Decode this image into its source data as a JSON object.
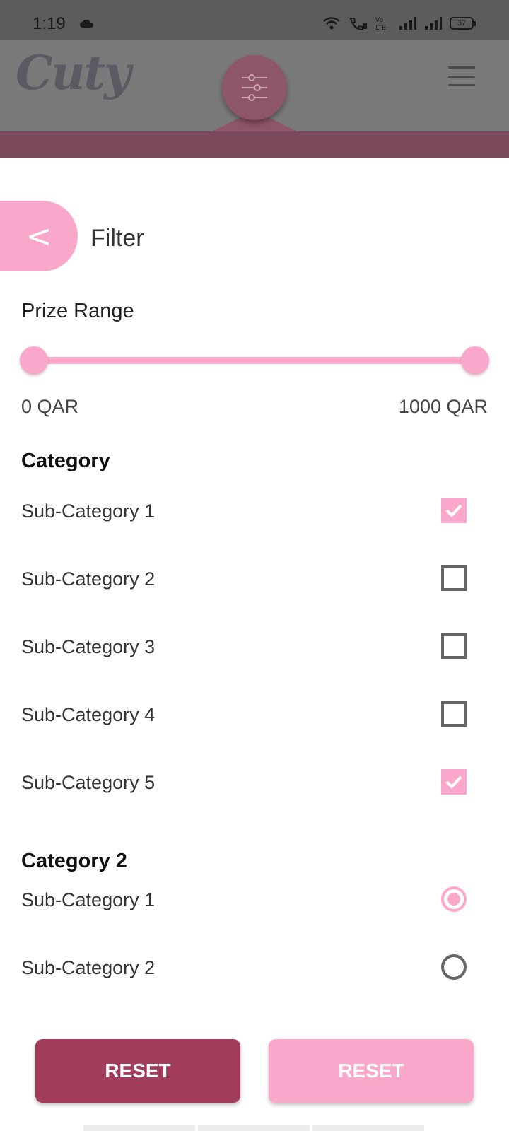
{
  "status_bar": {
    "time": "1:19",
    "battery": "37"
  },
  "header": {
    "logo_text": "Cuty"
  },
  "filter": {
    "back_label": "<",
    "title": "Filter"
  },
  "prize_range": {
    "label": "Prize Range",
    "min_label": "0 QAR",
    "max_label": "1000 QAR",
    "min_value": 0,
    "max_value": 1000
  },
  "categories": [
    {
      "title": "Category",
      "type": "checkbox",
      "items": [
        {
          "label": "Sub-Category 1",
          "checked": true
        },
        {
          "label": "Sub-Category 2",
          "checked": false
        },
        {
          "label": "Sub-Category 3",
          "checked": false
        },
        {
          "label": "Sub-Category 4",
          "checked": false
        },
        {
          "label": "Sub-Category 5",
          "checked": true
        }
      ]
    },
    {
      "title": "Category 2",
      "type": "radio",
      "items": [
        {
          "label": "Sub-Category 1",
          "checked": true
        },
        {
          "label": "Sub-Category 2",
          "checked": false
        }
      ]
    }
  ],
  "buttons": {
    "reset_primary": "RESET",
    "reset_secondary": "RESET"
  },
  "colors": {
    "accent_pink": "#f9a8cc",
    "primary_maroon": "#a13d5b"
  }
}
